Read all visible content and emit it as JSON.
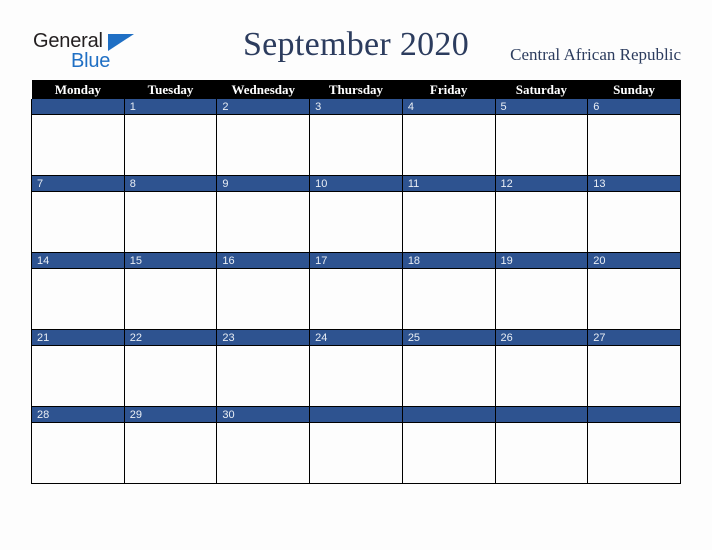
{
  "branding": {
    "logo_text_primary": "General",
    "logo_text_secondary": "Blue",
    "logo_icon": "triangle-flag-icon",
    "accent_color": "#1f6fc4"
  },
  "header": {
    "title": "September 2020",
    "country": "Central African Republic",
    "title_color": "#2c3c5e"
  },
  "calendar": {
    "month": "September",
    "year": "2020",
    "weekday_headers": [
      "Monday",
      "Tuesday",
      "Wednesday",
      "Thursday",
      "Friday",
      "Saturday",
      "Sunday"
    ],
    "header_bg_color": "#000000",
    "header_text_color": "#ffffff",
    "day_bar_color": "#2e5390",
    "day_number_color": "#e9eef5",
    "cell_bg_color": "#fdfdfd",
    "weeks": [
      {
        "days": [
          {
            "number": "",
            "empty": true
          },
          {
            "number": "1",
            "empty": false
          },
          {
            "number": "2",
            "empty": false
          },
          {
            "number": "3",
            "empty": false
          },
          {
            "number": "4",
            "empty": false
          },
          {
            "number": "5",
            "empty": false
          },
          {
            "number": "6",
            "empty": false
          }
        ]
      },
      {
        "days": [
          {
            "number": "7",
            "empty": false
          },
          {
            "number": "8",
            "empty": false
          },
          {
            "number": "9",
            "empty": false
          },
          {
            "number": "10",
            "empty": false
          },
          {
            "number": "11",
            "empty": false
          },
          {
            "number": "12",
            "empty": false
          },
          {
            "number": "13",
            "empty": false
          }
        ]
      },
      {
        "days": [
          {
            "number": "14",
            "empty": false
          },
          {
            "number": "15",
            "empty": false
          },
          {
            "number": "16",
            "empty": false
          },
          {
            "number": "17",
            "empty": false
          },
          {
            "number": "18",
            "empty": false
          },
          {
            "number": "19",
            "empty": false
          },
          {
            "number": "20",
            "empty": false
          }
        ]
      },
      {
        "days": [
          {
            "number": "21",
            "empty": false
          },
          {
            "number": "22",
            "empty": false
          },
          {
            "number": "23",
            "empty": false
          },
          {
            "number": "24",
            "empty": false
          },
          {
            "number": "25",
            "empty": false
          },
          {
            "number": "26",
            "empty": false
          },
          {
            "number": "27",
            "empty": false
          }
        ]
      },
      {
        "days": [
          {
            "number": "28",
            "empty": false
          },
          {
            "number": "29",
            "empty": false
          },
          {
            "number": "30",
            "empty": false
          },
          {
            "number": "",
            "empty": true
          },
          {
            "number": "",
            "empty": true
          },
          {
            "number": "",
            "empty": true
          },
          {
            "number": "",
            "empty": true
          }
        ]
      }
    ]
  }
}
